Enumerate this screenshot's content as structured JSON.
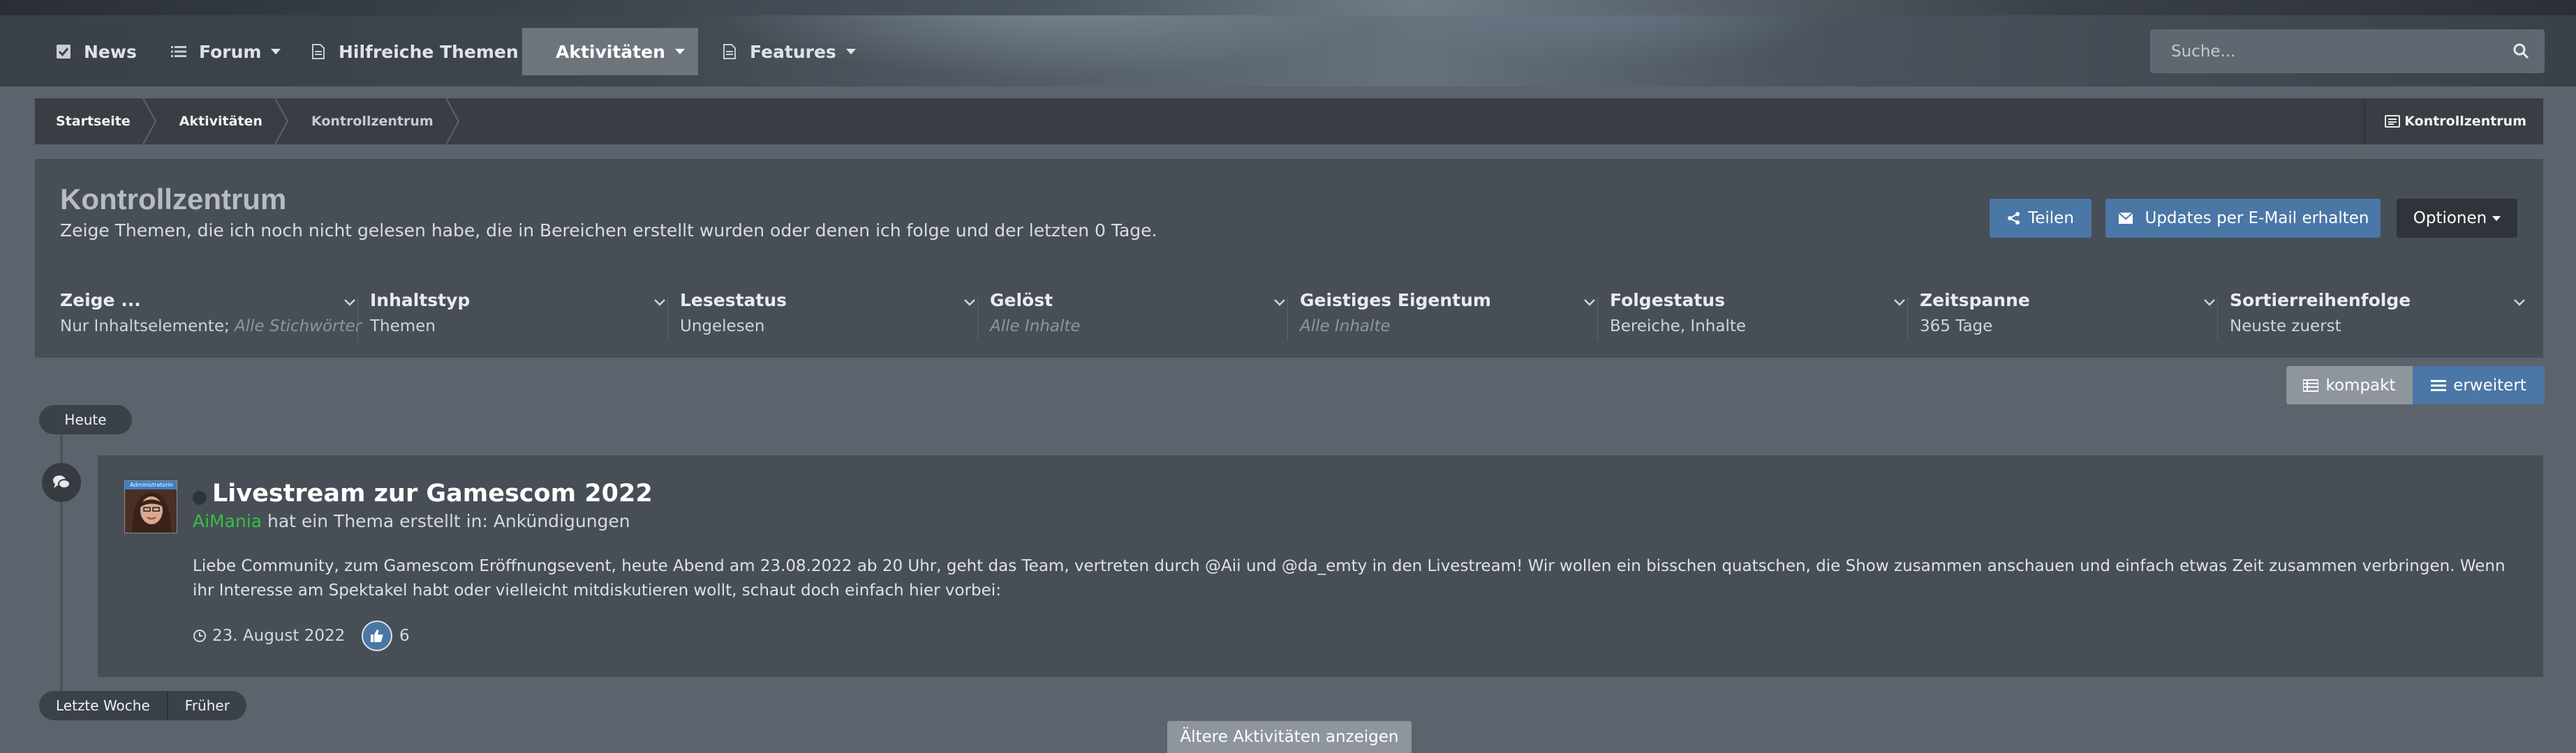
{
  "nav": {
    "items": [
      {
        "label": "News",
        "icon": "checkbox-icon",
        "dropdown": false
      },
      {
        "label": "Forum",
        "icon": "list-icon",
        "dropdown": true
      },
      {
        "label": "Hilfreiche Themen",
        "icon": "document-icon",
        "dropdown": true
      },
      {
        "label": "Aktivitäten",
        "icon": "megaphone-icon",
        "dropdown": true,
        "active": true
      },
      {
        "label": "Features",
        "icon": "document-icon",
        "dropdown": true
      }
    ],
    "search_placeholder": "Suche..."
  },
  "breadcrumb": {
    "items": [
      "Startseite",
      "Aktivitäten",
      "Kontrollzentrum"
    ],
    "right_label": "Kontrollzentrum"
  },
  "header": {
    "title": "Kontrollzentrum",
    "description": "Zeige Themen, die ich noch nicht gelesen habe, die in Bereichen erstellt wurden oder denen ich folge und der letzten 0 Tage.",
    "share_label": "Teilen",
    "email_label": "Updates per E-Mail erhalten",
    "options_label": "Optionen"
  },
  "filters": [
    {
      "label": "Zeige ...",
      "value": "Nur Inhaltselemente;",
      "placeholder": "Alle Stichwörter"
    },
    {
      "label": "Inhaltstyp",
      "value": "Themen",
      "placeholder": ""
    },
    {
      "label": "Lesestatus",
      "value": "Ungelesen",
      "placeholder": ""
    },
    {
      "label": "Gelöst",
      "value": "",
      "placeholder": "Alle Inhalte"
    },
    {
      "label": "Geistiges Eigentum",
      "value": "",
      "placeholder": "Alle Inhalte"
    },
    {
      "label": "Folgestatus",
      "value": "Bereiche, Inhalte",
      "placeholder": ""
    },
    {
      "label": "Zeitspanne",
      "value": "365 Tage",
      "placeholder": ""
    },
    {
      "label": "Sortierreihenfolge",
      "value": "Neuste zuerst",
      "placeholder": ""
    }
  ],
  "view": {
    "compact_label": "kompakt",
    "extended_label": "erweitert",
    "active": "erweitert"
  },
  "timeline": {
    "today_label": "Heute"
  },
  "activity": {
    "avatar_banner": "Administratorin",
    "title": "Livestream zur Gamescom 2022",
    "author": "AiMania",
    "meta_text": "hat ein Thema erstellt in: Ankündigungen",
    "body": "Liebe Community, zum Gamescom Eröffnungsevent, heute Abend am 23.08.2022 ab 20 Uhr, geht das Team, vertreten durch @Aii und @da_emty in den Livestream! Wir wollen ein bisschen quatschen, die Show zusammen anschauen und einfach etwas Zeit zusammen verbringen. Wenn ihr Interesse am Spektakel habt oder vielleicht mitdiskutieren wollt, schaut doch einfach hier vorbei:",
    "date": "23. August 2022",
    "likes": "6"
  },
  "bottom": {
    "periods": [
      "Letzte Woche",
      "Früher"
    ],
    "older_label": "Ältere Aktivitäten anzeigen"
  },
  "colors": {
    "accent_blue": "#4a77a6",
    "author_green": "#33c13f",
    "panel": "#474e56",
    "background": "#5c636c"
  }
}
